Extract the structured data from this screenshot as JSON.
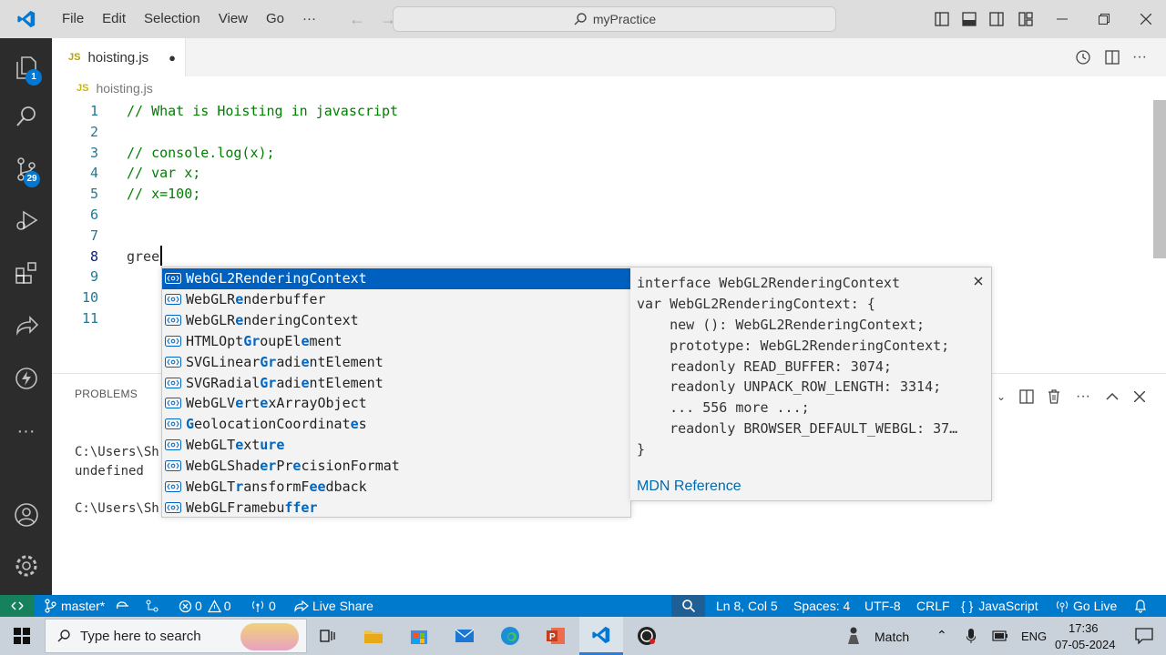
{
  "titlebar": {
    "menu": [
      "File",
      "Edit",
      "Selection",
      "View",
      "Go",
      "···"
    ],
    "command_center": "myPractice"
  },
  "activity": {
    "explorer_badge": "1",
    "scm_badge": "29"
  },
  "tab": {
    "badge": "JS",
    "label": "hoisting.js",
    "dirty": "●"
  },
  "breadcrumb": {
    "badge": "JS",
    "file": "hoisting.js"
  },
  "editor": {
    "lines": [
      {
        "n": "1",
        "text": "// What is Hoisting in javascript",
        "type": "comment"
      },
      {
        "n": "2",
        "text": "",
        "type": "plain"
      },
      {
        "n": "3",
        "text": "// console.log(x);",
        "type": "comment"
      },
      {
        "n": "4",
        "text": "// var x;",
        "type": "comment"
      },
      {
        "n": "5",
        "text": "// x=100;",
        "type": "comment"
      },
      {
        "n": "6",
        "text": "",
        "type": "plain"
      },
      {
        "n": "7",
        "text": "",
        "type": "plain"
      },
      {
        "n": "8",
        "text": "gree",
        "type": "plain"
      },
      {
        "n": "9",
        "text": "",
        "type": "plain"
      },
      {
        "n": "10",
        "text": "",
        "type": "plain"
      },
      {
        "n": "11",
        "text": "",
        "type": "plain"
      }
    ]
  },
  "panel": {
    "tab": "PROBLEMS",
    "terminal": [
      "C:\\Users\\Sh",
      "undefined",
      "",
      "C:\\Users\\Sh"
    ]
  },
  "suggest": {
    "items": [
      {
        "segs": [
          [
            "WebGL2RenderingContext",
            0
          ]
        ]
      },
      {
        "segs": [
          [
            "WebGLR",
            0
          ],
          [
            "e",
            1
          ],
          [
            "nderbuffer",
            0
          ]
        ]
      },
      {
        "segs": [
          [
            "WebGLR",
            0
          ],
          [
            "e",
            1
          ],
          [
            "nderingContext",
            0
          ]
        ]
      },
      {
        "segs": [
          [
            "HTMLOpt",
            0
          ],
          [
            "Gr",
            1
          ],
          [
            "oupEl",
            0
          ],
          [
            "e",
            1
          ],
          [
            "ment",
            0
          ]
        ]
      },
      {
        "segs": [
          [
            "SVGLinear",
            0
          ],
          [
            "Gr",
            1
          ],
          [
            "adi",
            0
          ],
          [
            "e",
            1
          ],
          [
            "ntElement",
            0
          ]
        ]
      },
      {
        "segs": [
          [
            "SVGRadial",
            0
          ],
          [
            "Gr",
            1
          ],
          [
            "adi",
            0
          ],
          [
            "e",
            1
          ],
          [
            "ntElement",
            0
          ]
        ]
      },
      {
        "segs": [
          [
            "WebGLV",
            0
          ],
          [
            "e",
            1
          ],
          [
            "rt",
            0
          ],
          [
            "e",
            1
          ],
          [
            "xArrayObject",
            0
          ]
        ]
      },
      {
        "segs": [
          [
            "G",
            1
          ],
          [
            "eolocationCoordinat",
            0
          ],
          [
            "e",
            1
          ],
          [
            "s",
            0
          ]
        ]
      },
      {
        "segs": [
          [
            "WebGLT",
            0
          ],
          [
            "e",
            1
          ],
          [
            "xt",
            0
          ],
          [
            "ure",
            1
          ]
        ]
      },
      {
        "segs": [
          [
            "WebGLShad",
            0
          ],
          [
            "er",
            1
          ],
          [
            "Pr",
            0
          ],
          [
            "e",
            1
          ],
          [
            "cisionFormat",
            0
          ]
        ]
      },
      {
        "segs": [
          [
            "WebGLT",
            0
          ],
          [
            "r",
            1
          ],
          [
            "ansformF",
            0
          ],
          [
            "ee",
            1
          ],
          [
            "dback",
            0
          ]
        ]
      },
      {
        "segs": [
          [
            "WebGLFramebu",
            0
          ],
          [
            "ffer",
            1
          ]
        ]
      }
    ]
  },
  "details": {
    "lines": [
      "interface WebGL2RenderingContext",
      "var WebGL2RenderingContext: {",
      "    new (): WebGL2RenderingContext;",
      "    prototype: WebGL2RenderingContext;",
      "    readonly READ_BUFFER: 3074;",
      "    readonly UNPACK_ROW_LENGTH: 3314;",
      "    ... 556 more ...;",
      "    readonly BROWSER_DEFAULT_WEBGL: 37…",
      "}"
    ],
    "link": "MDN Reference"
  },
  "statusbar": {
    "branch": "master*",
    "errors": "0",
    "warnings": "0",
    "ports": "0",
    "live_share": "Live Share",
    "position": "Ln 8, Col 5",
    "spaces": "Spaces: 4",
    "encoding": "UTF-8",
    "eol": "CRLF",
    "language": "JavaScript",
    "go_live": "Go Live"
  },
  "taskbar": {
    "search_placeholder": "Type here to search",
    "weather": "Match",
    "lang": "ENG",
    "time": "17:36",
    "date": "07-05-2024"
  },
  "colors": {
    "accent": "#007acc",
    "remote": "#16825d",
    "selection": "#0060c0",
    "comment": "#008000"
  }
}
